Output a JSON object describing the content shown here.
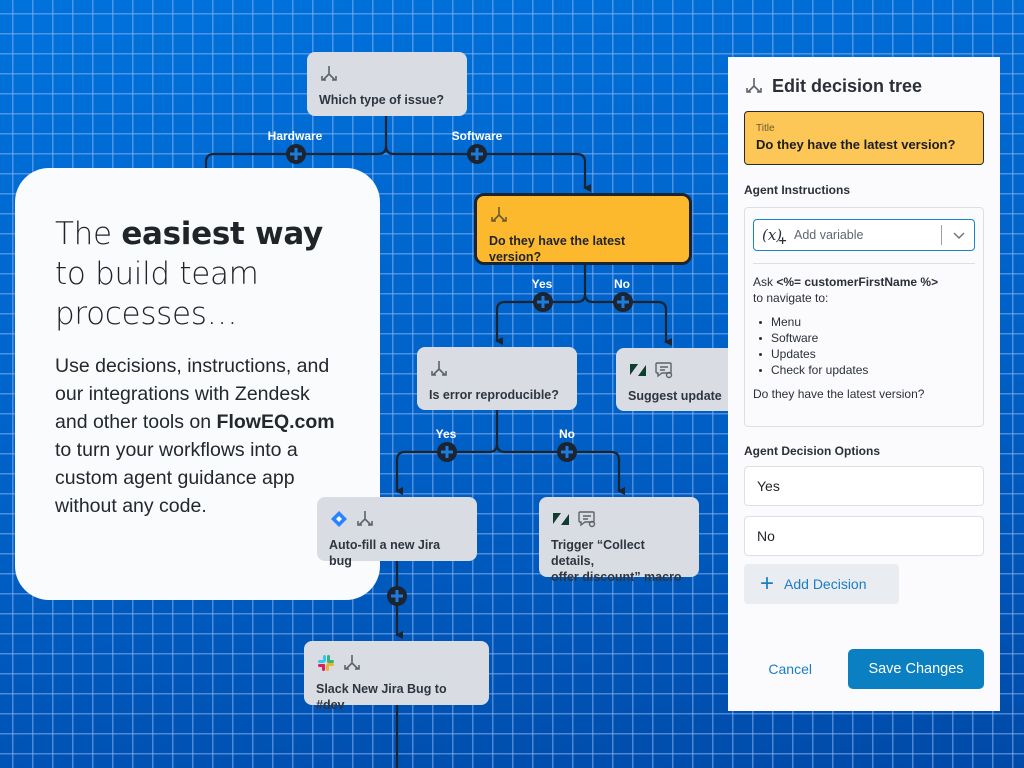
{
  "canvas": {
    "root_node": {
      "title": "Which type of issue?",
      "icons": [
        "decision-tree-icon"
      ]
    },
    "branches_root": [
      {
        "label": "Hardware"
      },
      {
        "label": "Software"
      }
    ],
    "active_node": {
      "title": "Do they have the latest version?",
      "icons": [
        "decision-tree-icon"
      ]
    },
    "branches_active": [
      {
        "label": "Yes"
      },
      {
        "label": "No"
      }
    ],
    "reproducible_node": {
      "title": "Is error reproducible?",
      "icons": [
        "decision-tree-icon"
      ]
    },
    "suggest_node": {
      "title": "Suggest update",
      "icons": [
        "zendesk-icon",
        "macro-chat-icon"
      ]
    },
    "branches_reproducible": [
      {
        "label": "Yes"
      },
      {
        "label": "No"
      }
    ],
    "jira_node": {
      "title": "Auto-fill a new Jira bug",
      "icons": [
        "jira-icon",
        "decision-tree-icon"
      ]
    },
    "macro_node": {
      "title_line1": "Trigger “Collect details,",
      "title_line2": "offer discount” macro",
      "icons": [
        "zendesk-icon",
        "macro-chat-icon"
      ]
    },
    "slack_node": {
      "title": "Slack New Jira Bug to #dev",
      "icons": [
        "slack-icon",
        "decision-tree-icon"
      ]
    }
  },
  "hero": {
    "headline_pre": "The ",
    "headline_bold": "easiest way",
    "headline_line2": "to build team",
    "headline_line3": "processes…",
    "body_pre": "Use decisions, instructions, and our integrations with Zendesk and other tools on ",
    "body_bold": "FlowEQ.com",
    "body_post": " to turn your workflows into a custom agent guidance app without any code."
  },
  "panel": {
    "header_title": "Edit decision tree",
    "title_field": {
      "label": "Title",
      "value": "Do they have the latest version?"
    },
    "instructions_label": "Agent Instructions",
    "add_variable_placeholder": "Add variable",
    "instructions": {
      "ask_prefix": "Ask ",
      "variable": "<%= customerFirstName %>",
      "line2": "to navigate to:",
      "steps": [
        "Menu",
        "Software",
        "Updates",
        "Check for updates"
      ],
      "question": "Do they have the latest version?"
    },
    "decision_options_label": "Agent Decision Options",
    "decision_options": [
      "Yes",
      "No"
    ],
    "add_decision_label": "Add Decision",
    "cancel_label": "Cancel",
    "save_label": "Save Changes"
  },
  "colors": {
    "background": "#0068d2",
    "active_node": "#fdb92e",
    "node": "#d9dde3",
    "primary_button": "#0a80c2",
    "link": "#1b7dc2"
  }
}
